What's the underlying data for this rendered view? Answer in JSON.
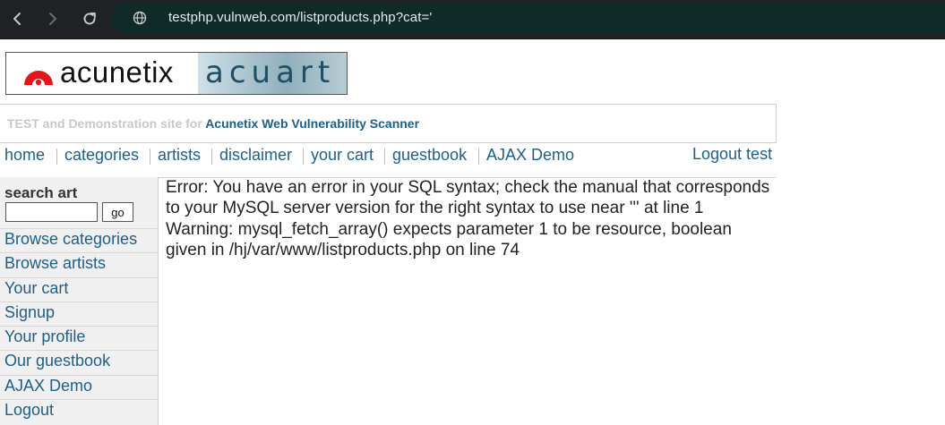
{
  "browser": {
    "url": "testphp.vulnweb.com/listproducts.php?cat='",
    "icons": {
      "back": "back-arrow-icon",
      "forward": "forward-arrow-icon",
      "reload": "reload-icon",
      "site_info": "site-info-icon"
    },
    "colors": {
      "chrome": "#202124",
      "address": "#0f2a27",
      "url_text": "#e8eaed"
    }
  },
  "site": {
    "logo": {
      "left_text": "acunetix",
      "right_text": "acuart"
    },
    "tagline": {
      "prefix": "TEST and Demonstration site for",
      "strong": "Acunetix Web Vulnerability Scanner"
    },
    "nav": {
      "items": [
        {
          "label": "home"
        },
        {
          "label": "categories"
        },
        {
          "label": "artists"
        },
        {
          "label": "disclaimer"
        },
        {
          "label": "your cart"
        },
        {
          "label": "guestbook"
        },
        {
          "label": "AJAX Demo"
        }
      ],
      "logout": "Logout test"
    },
    "sidebar": {
      "search_title": "search art",
      "search_value": "",
      "go_label": "go",
      "links": [
        {
          "label": "Browse categories"
        },
        {
          "label": "Browse artists"
        },
        {
          "label": "Your cart"
        },
        {
          "label": "Signup"
        },
        {
          "label": "Your profile"
        },
        {
          "label": "Our guestbook"
        },
        {
          "label": "AJAX Demo"
        },
        {
          "label": "Logout"
        }
      ]
    },
    "content": {
      "error_text": "Error: You have an error in your SQL syntax; check the manual that corresponds to your MySQL server version for the right syntax to use near ''' at line 1 Warning: mysql_fetch_array() expects parameter 1 to be resource, boolean given in /hj/var/www/listproducts.php on line 74"
    },
    "colors": {
      "link": "#1f5f86",
      "tagline_gray": "#c8c8c8",
      "sidebar_bg": "#f0f0f0"
    }
  }
}
